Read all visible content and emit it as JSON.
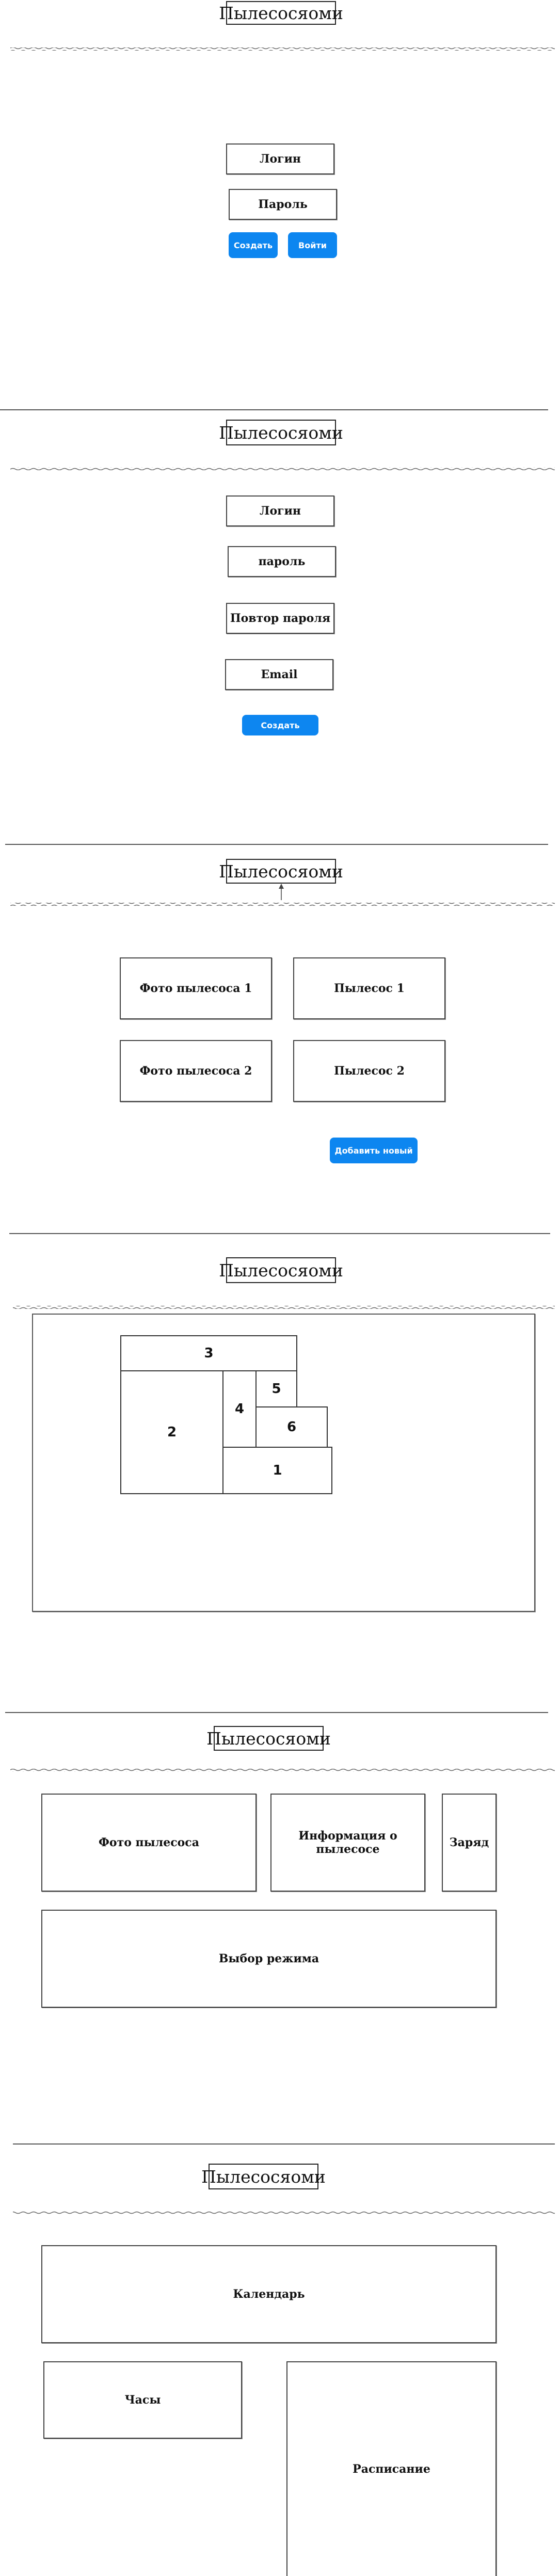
{
  "brand": "Пылесосяоми",
  "screen1": {
    "login": "Логин",
    "password": "Пароль",
    "create_btn": "Создать",
    "enter_btn": "Войти"
  },
  "screen2": {
    "login": "Логин",
    "password": "пароль",
    "repeat": "Повтор пароля",
    "email": "Email",
    "create_btn": "Создать"
  },
  "screen3": {
    "photo1": "Фото пылесоса 1",
    "vac1": "Пылесос 1",
    "photo2": "Фото пылесоса 2",
    "vac2": "Пылесос 2",
    "add_btn": "Добавить новый"
  },
  "screen4": {
    "cells": [
      "3",
      "2",
      "4",
      "5",
      "6",
      "1"
    ]
  },
  "screen5": {
    "photo": "Фото пылесоса",
    "info": "Информация о пылесосе",
    "charge": "Заряд",
    "mode": "Выбор режима"
  },
  "screen6": {
    "calendar": "Календарь",
    "clock": "Часы",
    "schedule": "Расписание"
  }
}
